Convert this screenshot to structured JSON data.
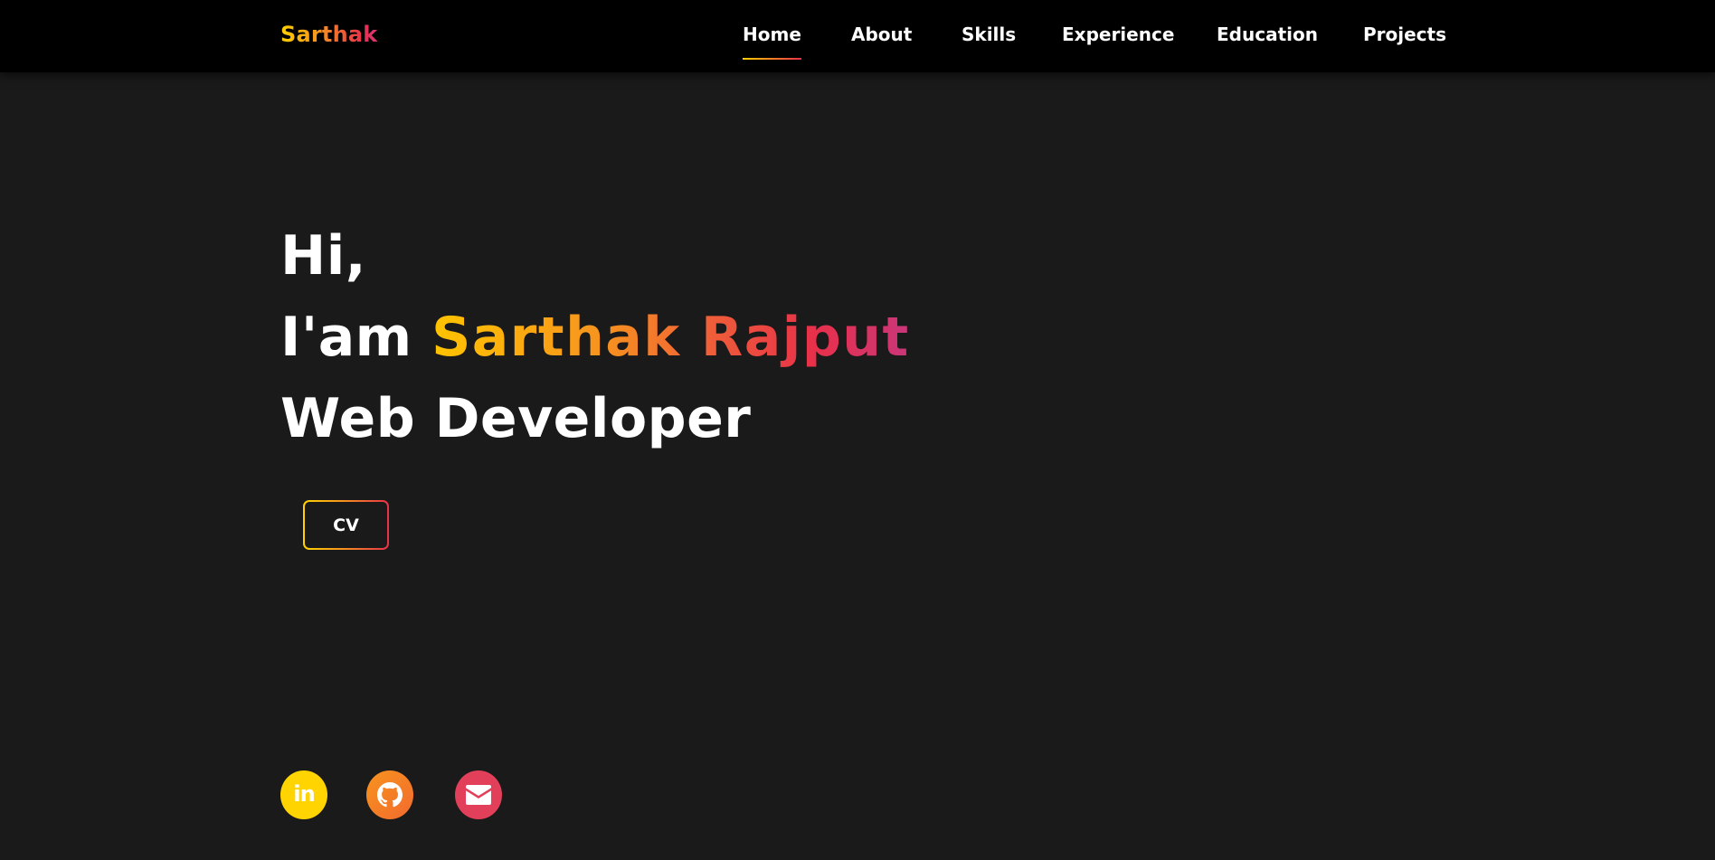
{
  "header": {
    "logo": "Sarthak",
    "nav": [
      {
        "label": "Home",
        "active": true
      },
      {
        "label": "About",
        "active": false
      },
      {
        "label": "Skills",
        "active": false
      },
      {
        "label": "Experience",
        "active": false
      },
      {
        "label": "Education",
        "active": false
      },
      {
        "label": "Projects",
        "active": false
      }
    ]
  },
  "hero": {
    "greeting": "Hi,",
    "intro_prefix": "I'am",
    "name": "Sarthak Rajput",
    "role": "Web Developer",
    "cv_label": "CV"
  },
  "social": [
    {
      "name": "linkedin-icon",
      "glyph": "in",
      "color": "#ffd400"
    },
    {
      "name": "github-icon",
      "color": "#f7941e"
    },
    {
      "name": "mail-icon",
      "color": "#e23f5a"
    }
  ],
  "colors": {
    "background": "#1a1a1a",
    "navbar": "#000000",
    "gradient_start": "#ffc400",
    "gradient_mid": "#f7941e",
    "gradient_end": "#d63776"
  }
}
